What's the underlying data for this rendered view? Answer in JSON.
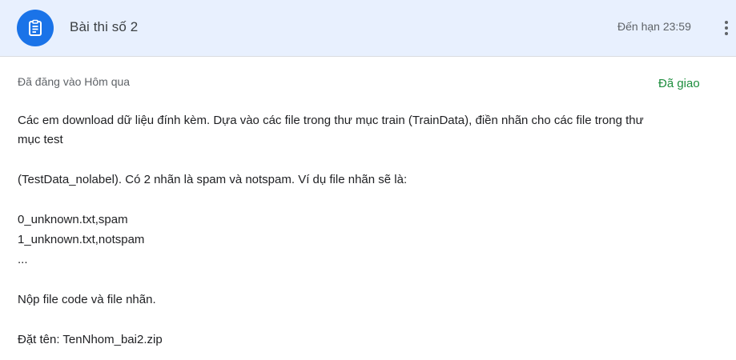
{
  "header": {
    "icon": "assignment-clipboard-icon",
    "title": "Bài thi số 2",
    "due": "Đến hạn 23:59",
    "more_icon": "more-vertical-icon",
    "background_color": "#e8f0fe",
    "icon_color": "#1a73e8"
  },
  "meta": {
    "posted": "Đã đăng vào Hôm qua",
    "status": "Đã giao",
    "status_color": "#1e8e3e"
  },
  "instructions": {
    "line1": "Các em download dữ liệu đính kèm. Dựa vào các file trong thư mục train (TrainData), điền nhãn cho các file trong thư",
    "line2": "mục test",
    "line3": "(TestData_nolabel). Có 2 nhãn là spam và notspam. Ví dụ file nhãn sẽ là:",
    "line4": "0_unknown.txt,spam",
    "line5": "1_unknown.txt,notspam",
    "line6": "...",
    "line7": "Nộp file code và file nhãn.",
    "line8": "Đặt tên: TenNhom_bai2.zip"
  }
}
